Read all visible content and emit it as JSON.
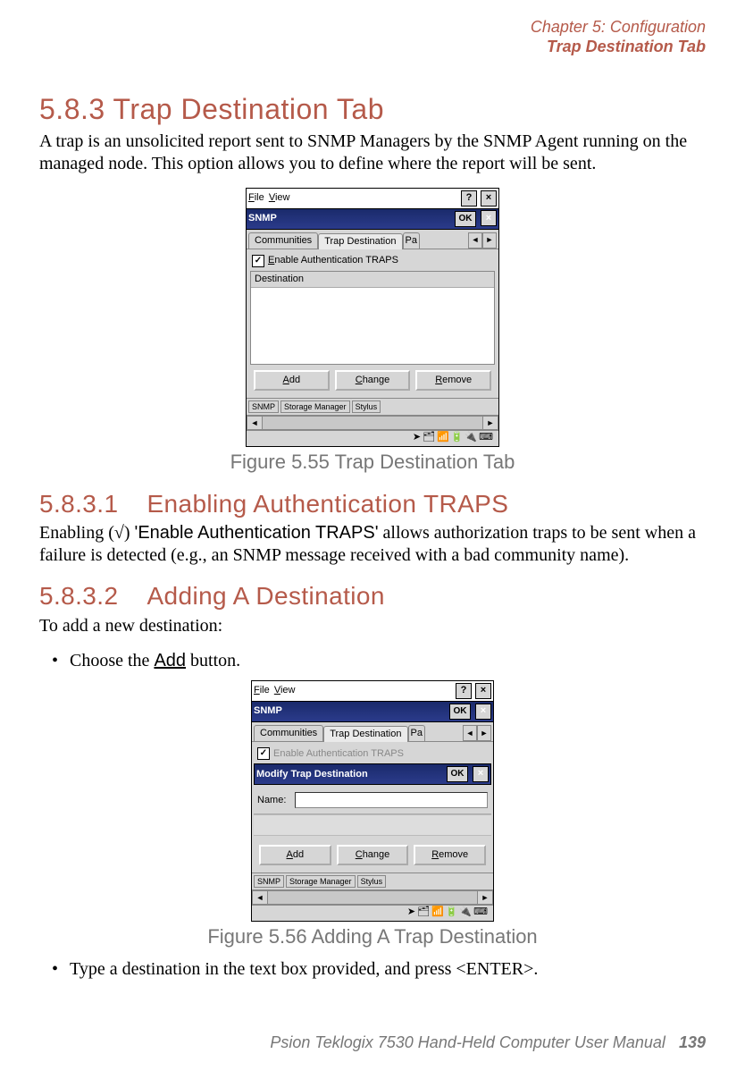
{
  "header": {
    "chapter": "Chapter 5: Configuration",
    "subtitle": "Trap Destination Tab"
  },
  "section": {
    "number_title": "5.8.3  Trap Destination Tab",
    "para1": "A trap is an unsolicited report sent to SNMP Managers by the SNMP Agent running on the managed node. This option allows you to define where the report will be sent."
  },
  "fig1": {
    "menu_file": "File",
    "menu_view": "View",
    "help": "?",
    "close": "×",
    "title": "SNMP",
    "ok": "OK",
    "tab_communities": "Communities",
    "tab_trap": "Trap Destination",
    "tab_pa": "Pa",
    "chk_label": "Enable Authentication TRAPS",
    "dest_header": "Destination",
    "btn_add": "Add",
    "btn_change": "Change",
    "btn_remove": "Remove",
    "task1": "SNMP",
    "task2": "Storage Manager",
    "task3": "Stylus",
    "tray": "➤🗂📶🔋🔌⌨",
    "caption": "Figure 5.55 Trap Destination Tab"
  },
  "sub1": {
    "num": "5.8.3.1",
    "title": "Enabling Authentication TRAPS",
    "para_a": "Enabling (√) ",
    "para_quoted": "'Enable Authentication TRAPS'",
    "para_b": " allows authorization traps to be sent when a failure is detected (e.g., an SNMP message received with a bad community name)."
  },
  "sub2": {
    "num": "5.8.3.2",
    "title": "Adding A Destination",
    "para": "To add a new destination:",
    "bullet1_a": "Choose the ",
    "bullet1_btn": "Add",
    "bullet1_b": " button."
  },
  "fig2": {
    "menu_file": "File",
    "menu_view": "View",
    "help": "?",
    "close": "×",
    "title": "SNMP",
    "ok": "OK",
    "tab_communities": "Communities",
    "tab_trap": "Trap Destination",
    "tab_pa": "Pa",
    "chk_label": "Enable Authentication TRAPS",
    "dialog_title": "Modify Trap Destination",
    "name_label": "Name:",
    "btn_add": "Add",
    "btn_change": "Change",
    "btn_remove": "Remove",
    "task1": "SNMP",
    "task2": "Storage Manager",
    "task3": "Stylus",
    "tray": "➤🗂📶🔋🔌⌨",
    "caption": "Figure 5.56 Adding A Trap Destination"
  },
  "bullet2": "Type a destination in the text box provided, and press <ENTER>.",
  "footer": {
    "text": "Psion Teklogix 7530 Hand-Held Computer User Manual",
    "page": "139"
  }
}
